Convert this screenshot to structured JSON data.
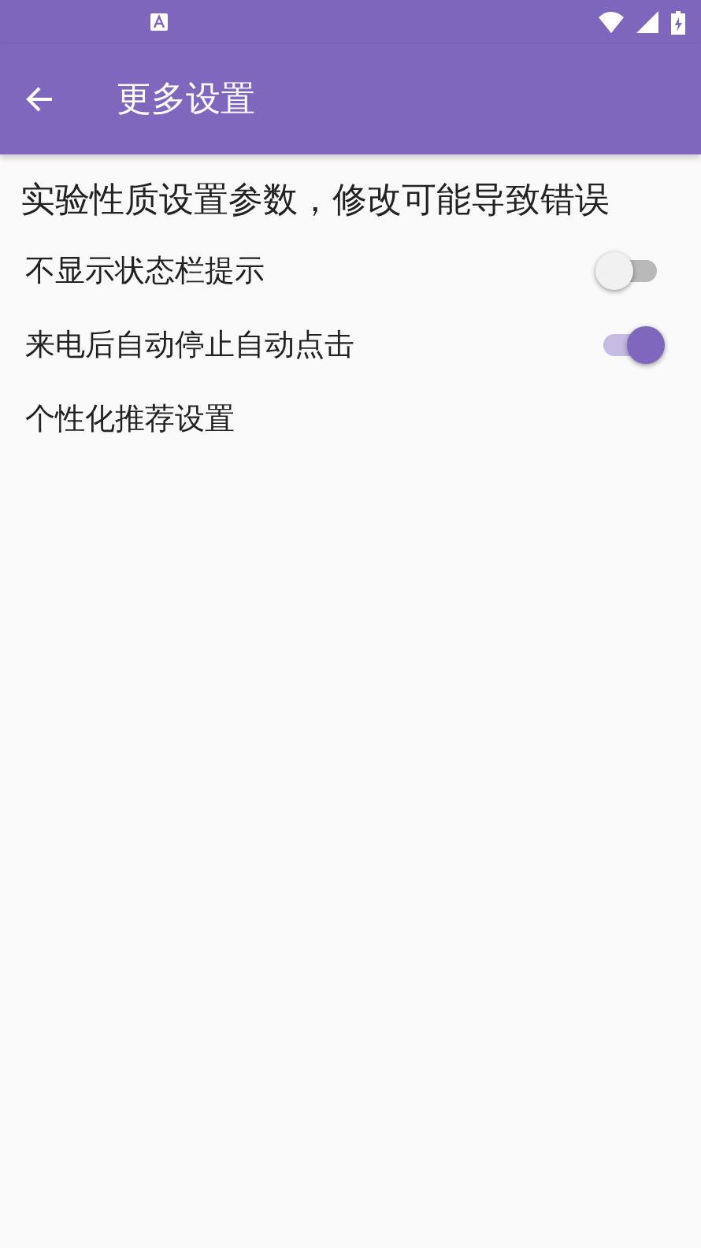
{
  "app_bar": {
    "title": "更多设置"
  },
  "notice": "实验性质设置参数，修改可能导致错误",
  "settings": [
    {
      "kind": "switch",
      "label": "不显示状态栏提示",
      "on": false
    },
    {
      "kind": "switch",
      "label": "来电后自动停止自动点击",
      "on": true
    },
    {
      "kind": "link",
      "label": "个性化推荐设置"
    }
  ]
}
